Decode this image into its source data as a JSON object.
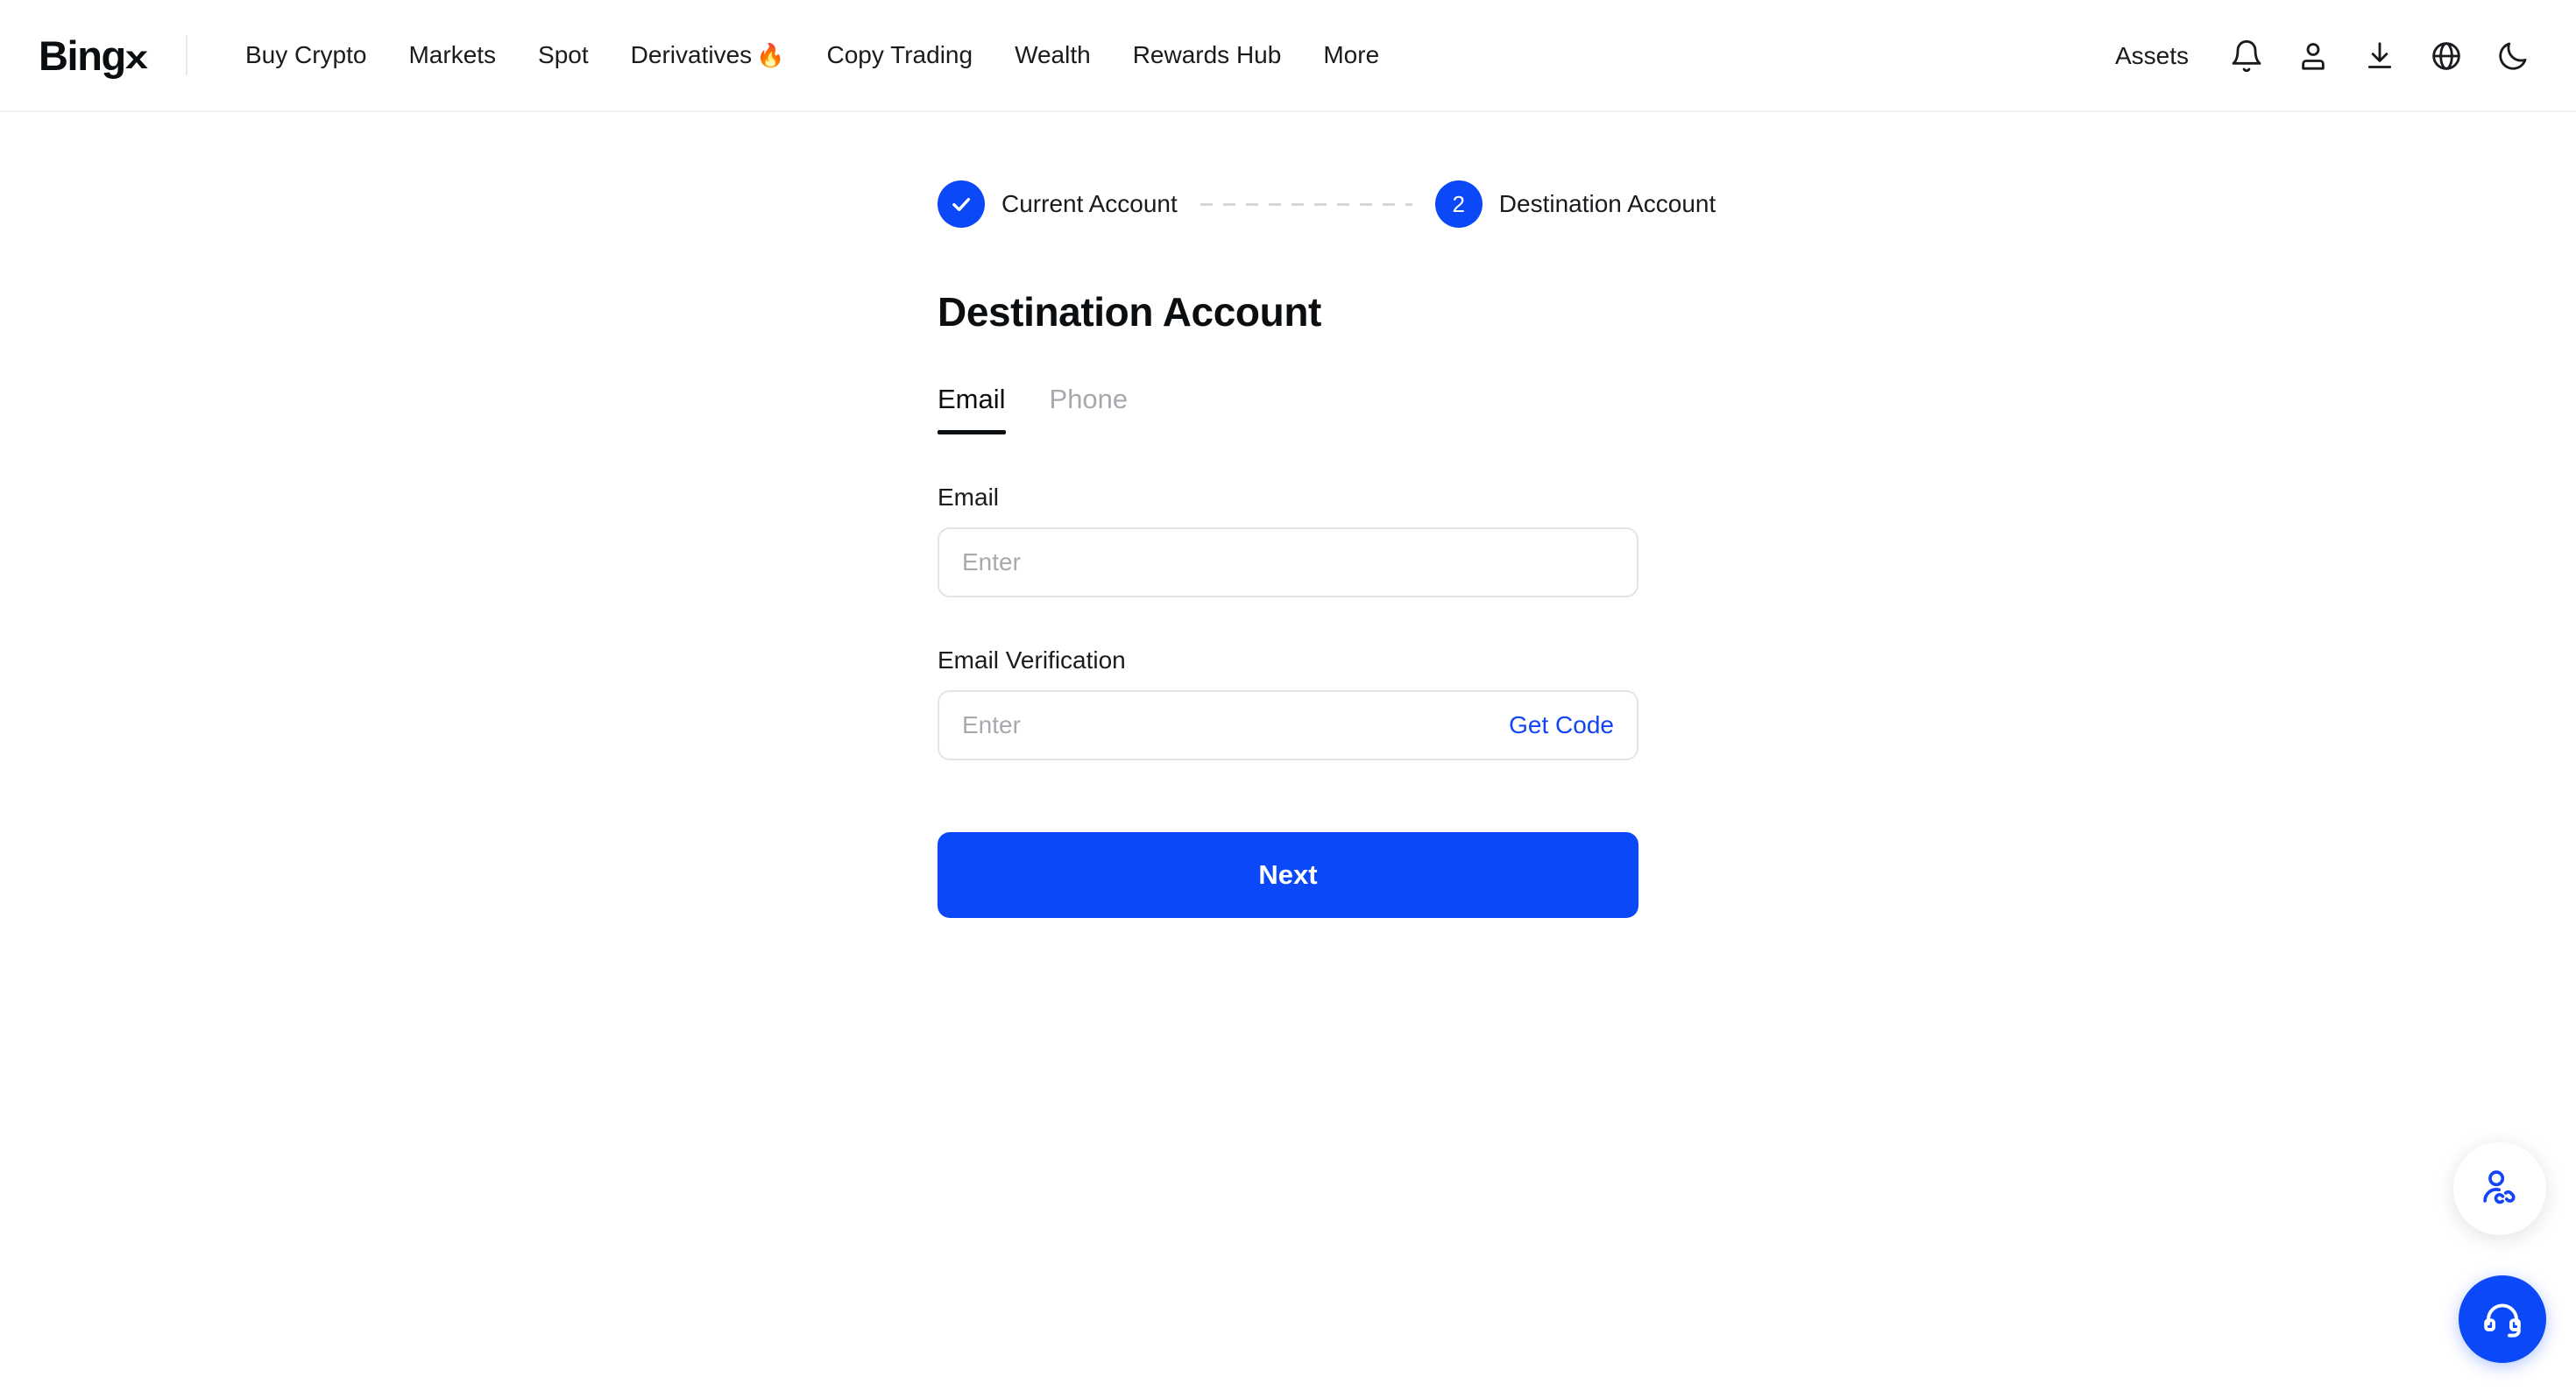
{
  "header": {
    "logo_text": "Bing",
    "logo_mark": "x",
    "nav": [
      {
        "label": "Buy Crypto",
        "emoji": ""
      },
      {
        "label": "Markets",
        "emoji": ""
      },
      {
        "label": "Spot",
        "emoji": ""
      },
      {
        "label": "Derivatives",
        "emoji": "🔥"
      },
      {
        "label": "Copy Trading",
        "emoji": ""
      },
      {
        "label": "Wealth",
        "emoji": ""
      },
      {
        "label": "Rewards Hub",
        "emoji": ""
      },
      {
        "label": "More",
        "emoji": ""
      }
    ],
    "assets_label": "Assets",
    "icons": [
      "notification-bell-icon",
      "user-account-icon",
      "download-app-icon",
      "language-globe-icon",
      "dark-mode-moon-icon"
    ]
  },
  "stepper": {
    "step1": {
      "label": "Current Account",
      "state": "completed",
      "marker": "check"
    },
    "step2": {
      "label": "Destination Account",
      "state": "active",
      "marker": "2"
    }
  },
  "main": {
    "title": "Destination Account",
    "tabs": [
      {
        "label": "Email",
        "active": true
      },
      {
        "label": "Phone",
        "active": false
      }
    ],
    "fields": {
      "email": {
        "label": "Email",
        "placeholder": "Enter",
        "value": ""
      },
      "verification": {
        "label": "Email Verification",
        "placeholder": "Enter",
        "value": "",
        "action_label": "Get Code"
      }
    },
    "submit_label": "Next"
  },
  "floating": {
    "referral_icon": "user-referral-link-icon",
    "support_icon": "customer-support-headset-icon"
  },
  "colors": {
    "brand_blue": "#0b48f7",
    "link_blue": "#1245f5",
    "text_primary": "#0b0e11",
    "text_muted": "#a6a9ad",
    "border": "#e2e4e7",
    "page_bg": "#ffffff"
  }
}
